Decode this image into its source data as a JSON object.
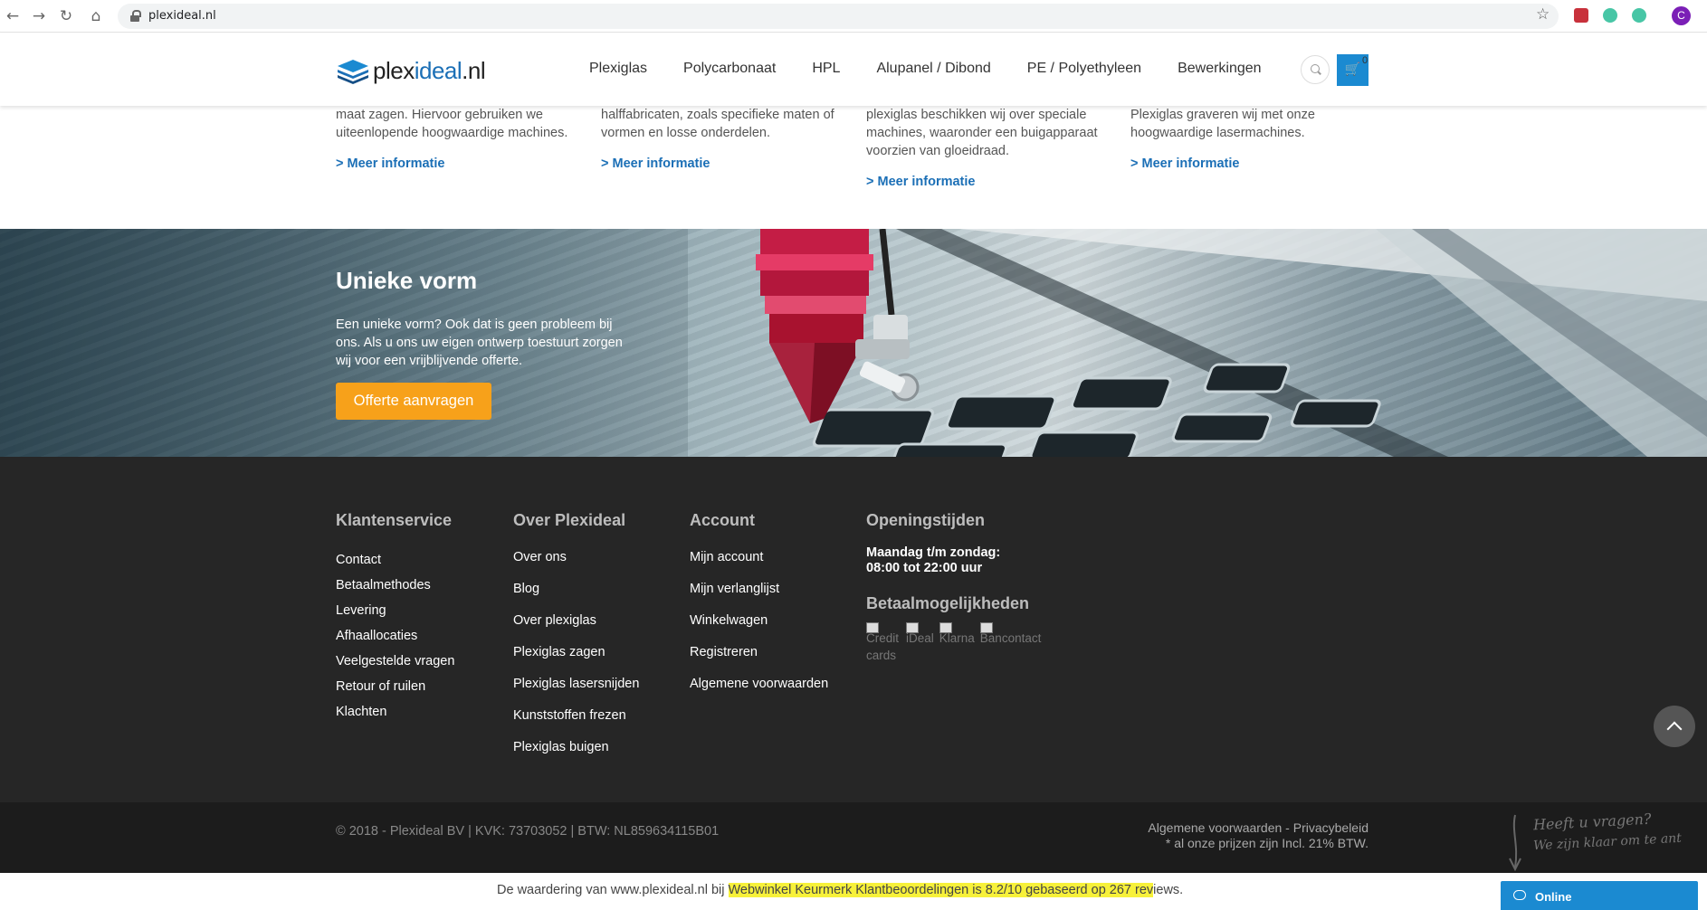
{
  "browser": {
    "url": "plexideal.nl",
    "profile_initial": "C"
  },
  "header": {
    "logo_part1": "plex",
    "logo_part2": "ideal",
    "logo_part3": ".nl",
    "nav": [
      "Plexiglas",
      "Polycarbonaat",
      "HPL",
      "Alupanel / Dibond",
      "PE / Polyethyleen",
      "Bewerkingen"
    ],
    "cart_count": "0"
  },
  "info_columns": [
    {
      "text": "maat zagen. Hiervoor gebruiken we uiteenlopende hoogwaardige machines.",
      "link": "> Meer informatie"
    },
    {
      "text": "halffabricaten, zoals specifieke maten of vormen en losse onderdelen.",
      "link": "> Meer informatie"
    },
    {
      "text": "plexiglas beschikken wij over speciale machines, waaronder een buigapparaat voorzien van gloeidraad.",
      "link": "> Meer informatie"
    },
    {
      "text": "Plexiglas graveren wij met onze hoogwaardige lasermachines.",
      "link": "> Meer informatie"
    }
  ],
  "hero": {
    "title": "Unieke vorm",
    "text": "Een unieke vorm? Ook dat is geen probleem bij ons. Als u ons uw eigen ontwerp toestuurt zorgen wij voor een vrijblijvende offerte.",
    "button": "Offerte aanvragen"
  },
  "footer": {
    "klantenservice": {
      "title": "Klantenservice",
      "items": [
        "Contact",
        "Betaalmethodes",
        "Levering",
        "Afhaallocaties",
        "Veelgestelde vragen",
        "Retour of ruilen",
        "Klachten"
      ]
    },
    "over": {
      "title": "Over Plexideal",
      "items": [
        "Over ons",
        "Blog",
        "Over plexiglas",
        "Plexiglas zagen",
        "Plexiglas lasersnijden",
        "Kunststoffen frezen",
        "Plexiglas buigen"
      ]
    },
    "account": {
      "title": "Account",
      "items": [
        "Mijn account",
        "Mijn verlanglijst",
        "Winkelwagen",
        "Registreren",
        "Algemene voorwaarden"
      ]
    },
    "openingstijden": {
      "title": "Openingstijden",
      "line1": "Maandag t/m zondag:",
      "line2": "08:00 tot 22:00 uur"
    },
    "betaal": {
      "title": "Betaalmogelijkheden",
      "methods": [
        "Credit cards",
        "iDeal",
        "Klarna",
        "Bancontact"
      ]
    }
  },
  "bottom": {
    "copyright": "© 2018 - Plexideal BV | KVK: 73703052 | BTW: NL859634115B01",
    "legal_line1": "Algemene voorwaarden - Privacybeleid",
    "legal_line2": "* al onze prijzen zijn Incl. 21% BTW.",
    "chat_hint1": "Heeft u vragen?",
    "chat_hint2": "We zijn klaar om te ant"
  },
  "review": {
    "before": "De waardering van www.plexideal.nl bij ",
    "highlight": "Webwinkel Keurmerk Klantbeoordelingen is 8.2/10 gebaseerd op 267 rev",
    "after": "iews."
  },
  "chat": {
    "label": "Online"
  },
  "colors": {
    "brand_blue": "#1b6fb6",
    "cta_orange": "#f7a11a",
    "footer_bg": "#262626",
    "highlight": "#f7f13a"
  }
}
